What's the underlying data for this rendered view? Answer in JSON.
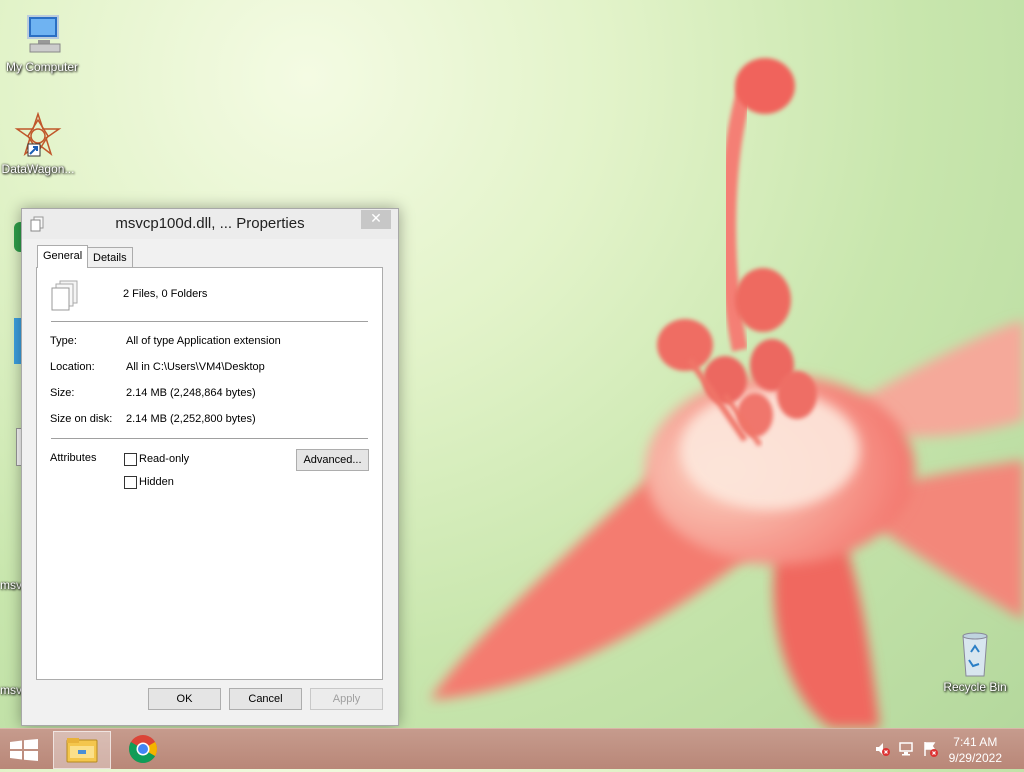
{
  "desktop": {
    "icons": [
      {
        "label": "My Computer",
        "icon": "computer-icon"
      },
      {
        "label": "DataWagon...",
        "icon": "datawagon-shortcut-icon"
      },
      {
        "label": "msv",
        "icon": "file-icon"
      },
      {
        "label": "msv",
        "icon": "file-icon"
      },
      {
        "label": "Recycle Bin",
        "icon": "recycle-bin-icon"
      }
    ]
  },
  "dialog": {
    "title": "msvcp100d.dll, ... Properties",
    "close_glyph": "✕",
    "tabs": [
      {
        "label": "General",
        "active": true
      },
      {
        "label": "Details",
        "active": false
      }
    ],
    "summary": "2 Files, 0 Folders",
    "fields": {
      "type_label": "Type:",
      "type_value": "All of type Application extension",
      "location_label": "Location:",
      "location_value": "All in C:\\Users\\VM4\\Desktop",
      "size_label": "Size:",
      "size_value": "2.14 MB (2,248,864 bytes)",
      "size_on_disk_label": "Size on disk:",
      "size_on_disk_value": "2.14 MB (2,252,800 bytes)"
    },
    "attributes": {
      "label": "Attributes",
      "readonly_label": "Read-only",
      "readonly_checked": false,
      "hidden_label": "Hidden",
      "hidden_checked": false,
      "advanced_label": "Advanced..."
    },
    "buttons": {
      "ok": "OK",
      "cancel": "Cancel",
      "apply": "Apply"
    }
  },
  "taskbar": {
    "pinned": [
      {
        "name": "File Explorer",
        "icon": "file-explorer-icon"
      },
      {
        "name": "Google Chrome",
        "icon": "chrome-icon"
      }
    ],
    "tray_icons": [
      "volume-muted-icon",
      "network-icon",
      "action-center-icon"
    ],
    "clock_time": "7:41 AM",
    "clock_date": "9/29/2022"
  },
  "colors": {
    "taskbar": "#bf8f80",
    "close_button": "#c7c7c7",
    "flower": "#f27a6f"
  }
}
